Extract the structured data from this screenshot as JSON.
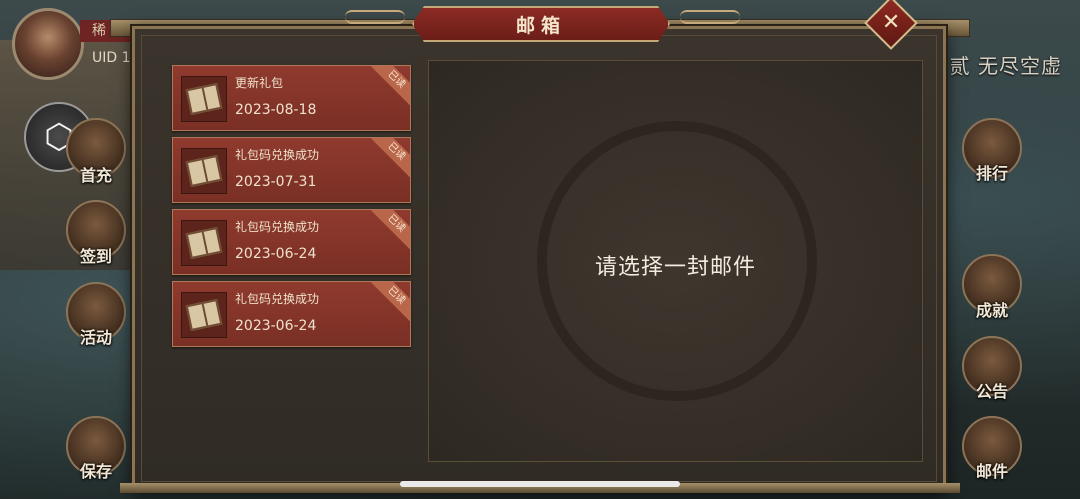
{
  "hud": {
    "player_name": "稀",
    "uid_label": "UID 1",
    "server_name": "贰 无尽空虚"
  },
  "left_menu": [
    {
      "label": "首充",
      "icon": "gift-chest-icon"
    },
    {
      "label": "签到",
      "icon": "checkin-scroll-icon"
    },
    {
      "label": "活动",
      "icon": "event-treasure-icon"
    },
    {
      "label": "保存",
      "icon": "save-emblem-icon"
    }
  ],
  "right_menu": [
    {
      "label": "排行",
      "icon": "ranking-plaque-icon"
    },
    {
      "label": "成就",
      "icon": "achievement-jade-icon"
    },
    {
      "label": "公告",
      "icon": "announcement-scroll-icon"
    },
    {
      "label": "邮件",
      "icon": "mail-envelope-icon"
    }
  ],
  "dialog": {
    "title": "邮箱",
    "close_icon": "✕",
    "empty_message": "请选择一封邮件"
  },
  "mails": [
    {
      "title": "更新礼包",
      "date": "2023-08-18",
      "status": "已读"
    },
    {
      "title": "礼包码兑换成功",
      "date": "2023-07-31",
      "status": "已读"
    },
    {
      "title": "礼包码兑换成功",
      "date": "2023-06-24",
      "status": "已读"
    },
    {
      "title": "礼包码兑换成功",
      "date": "2023-06-24",
      "status": "已读"
    }
  ]
}
